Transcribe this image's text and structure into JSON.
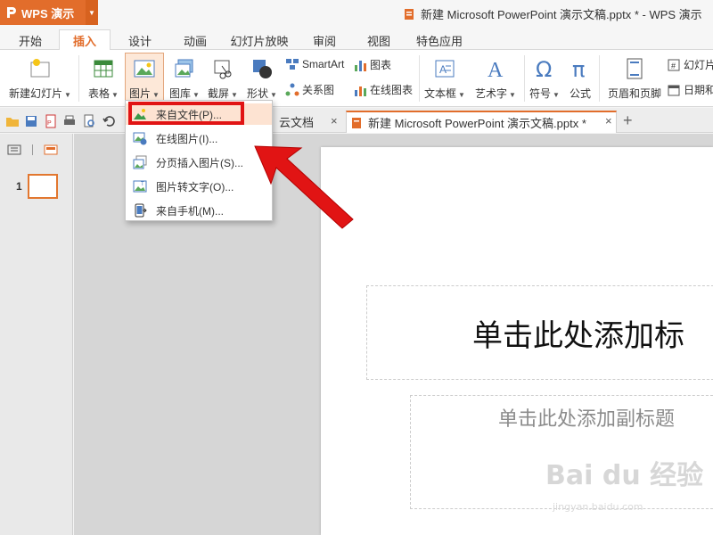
{
  "app": {
    "name": "WPS 演示",
    "window_title": "新建 Microsoft PowerPoint 演示文稿.pptx * - WPS 演示",
    "brand_color": "#e26d2b"
  },
  "menu": {
    "tabs": [
      {
        "label": "开始",
        "active": false
      },
      {
        "label": "插入",
        "active": true
      },
      {
        "label": "设计",
        "active": false
      },
      {
        "label": "动画",
        "active": false
      },
      {
        "label": "幻灯片放映",
        "active": false
      },
      {
        "label": "审阅",
        "active": false
      },
      {
        "label": "视图",
        "active": false
      },
      {
        "label": "特色应用",
        "active": false
      }
    ]
  },
  "ribbon": {
    "new_slide": "新建幻灯片",
    "table": "表格",
    "picture": "图片",
    "gallery": "图库",
    "screenshot": "截屏",
    "shapes": "形状",
    "smartart": "SmartArt",
    "chart": "图表",
    "relation": "关系图",
    "online_chart": "在线图表",
    "textbox": "文本框",
    "wordart": "艺术字",
    "symbol": "符号",
    "formula": "公式",
    "header_footer": "页眉和页脚",
    "slide_number": "幻灯片",
    "date_time": "日期和"
  },
  "doc_tabs": [
    {
      "label": "云文档",
      "active": false
    },
    {
      "label": "新建 Microsoft PowerPoint 演示文稿.pptx *",
      "active": true
    }
  ],
  "slide_pane": {
    "slide_number": "1"
  },
  "slide": {
    "title_placeholder": "单击此处添加标",
    "subtitle_placeholder": "单击此处添加副标题"
  },
  "picture_menu": {
    "items": [
      {
        "label": "来自文件(P)...",
        "icon": "image-file-icon",
        "highlighted": true
      },
      {
        "label": "在线图片(I)...",
        "icon": "online-image-icon",
        "highlighted": false
      },
      {
        "label": "分页插入图片(S)...",
        "icon": "paged-insert-icon",
        "highlighted": false
      },
      {
        "label": "图片转文字(O)...",
        "icon": "image-to-text-icon",
        "highlighted": false
      },
      {
        "label": "来自手机(M)...",
        "icon": "phone-icon",
        "highlighted": false
      }
    ]
  },
  "annotation": {
    "color": "#e11414"
  },
  "watermark": {
    "text": "Bai du 经验",
    "sub": "jingyan.baidu.com"
  }
}
